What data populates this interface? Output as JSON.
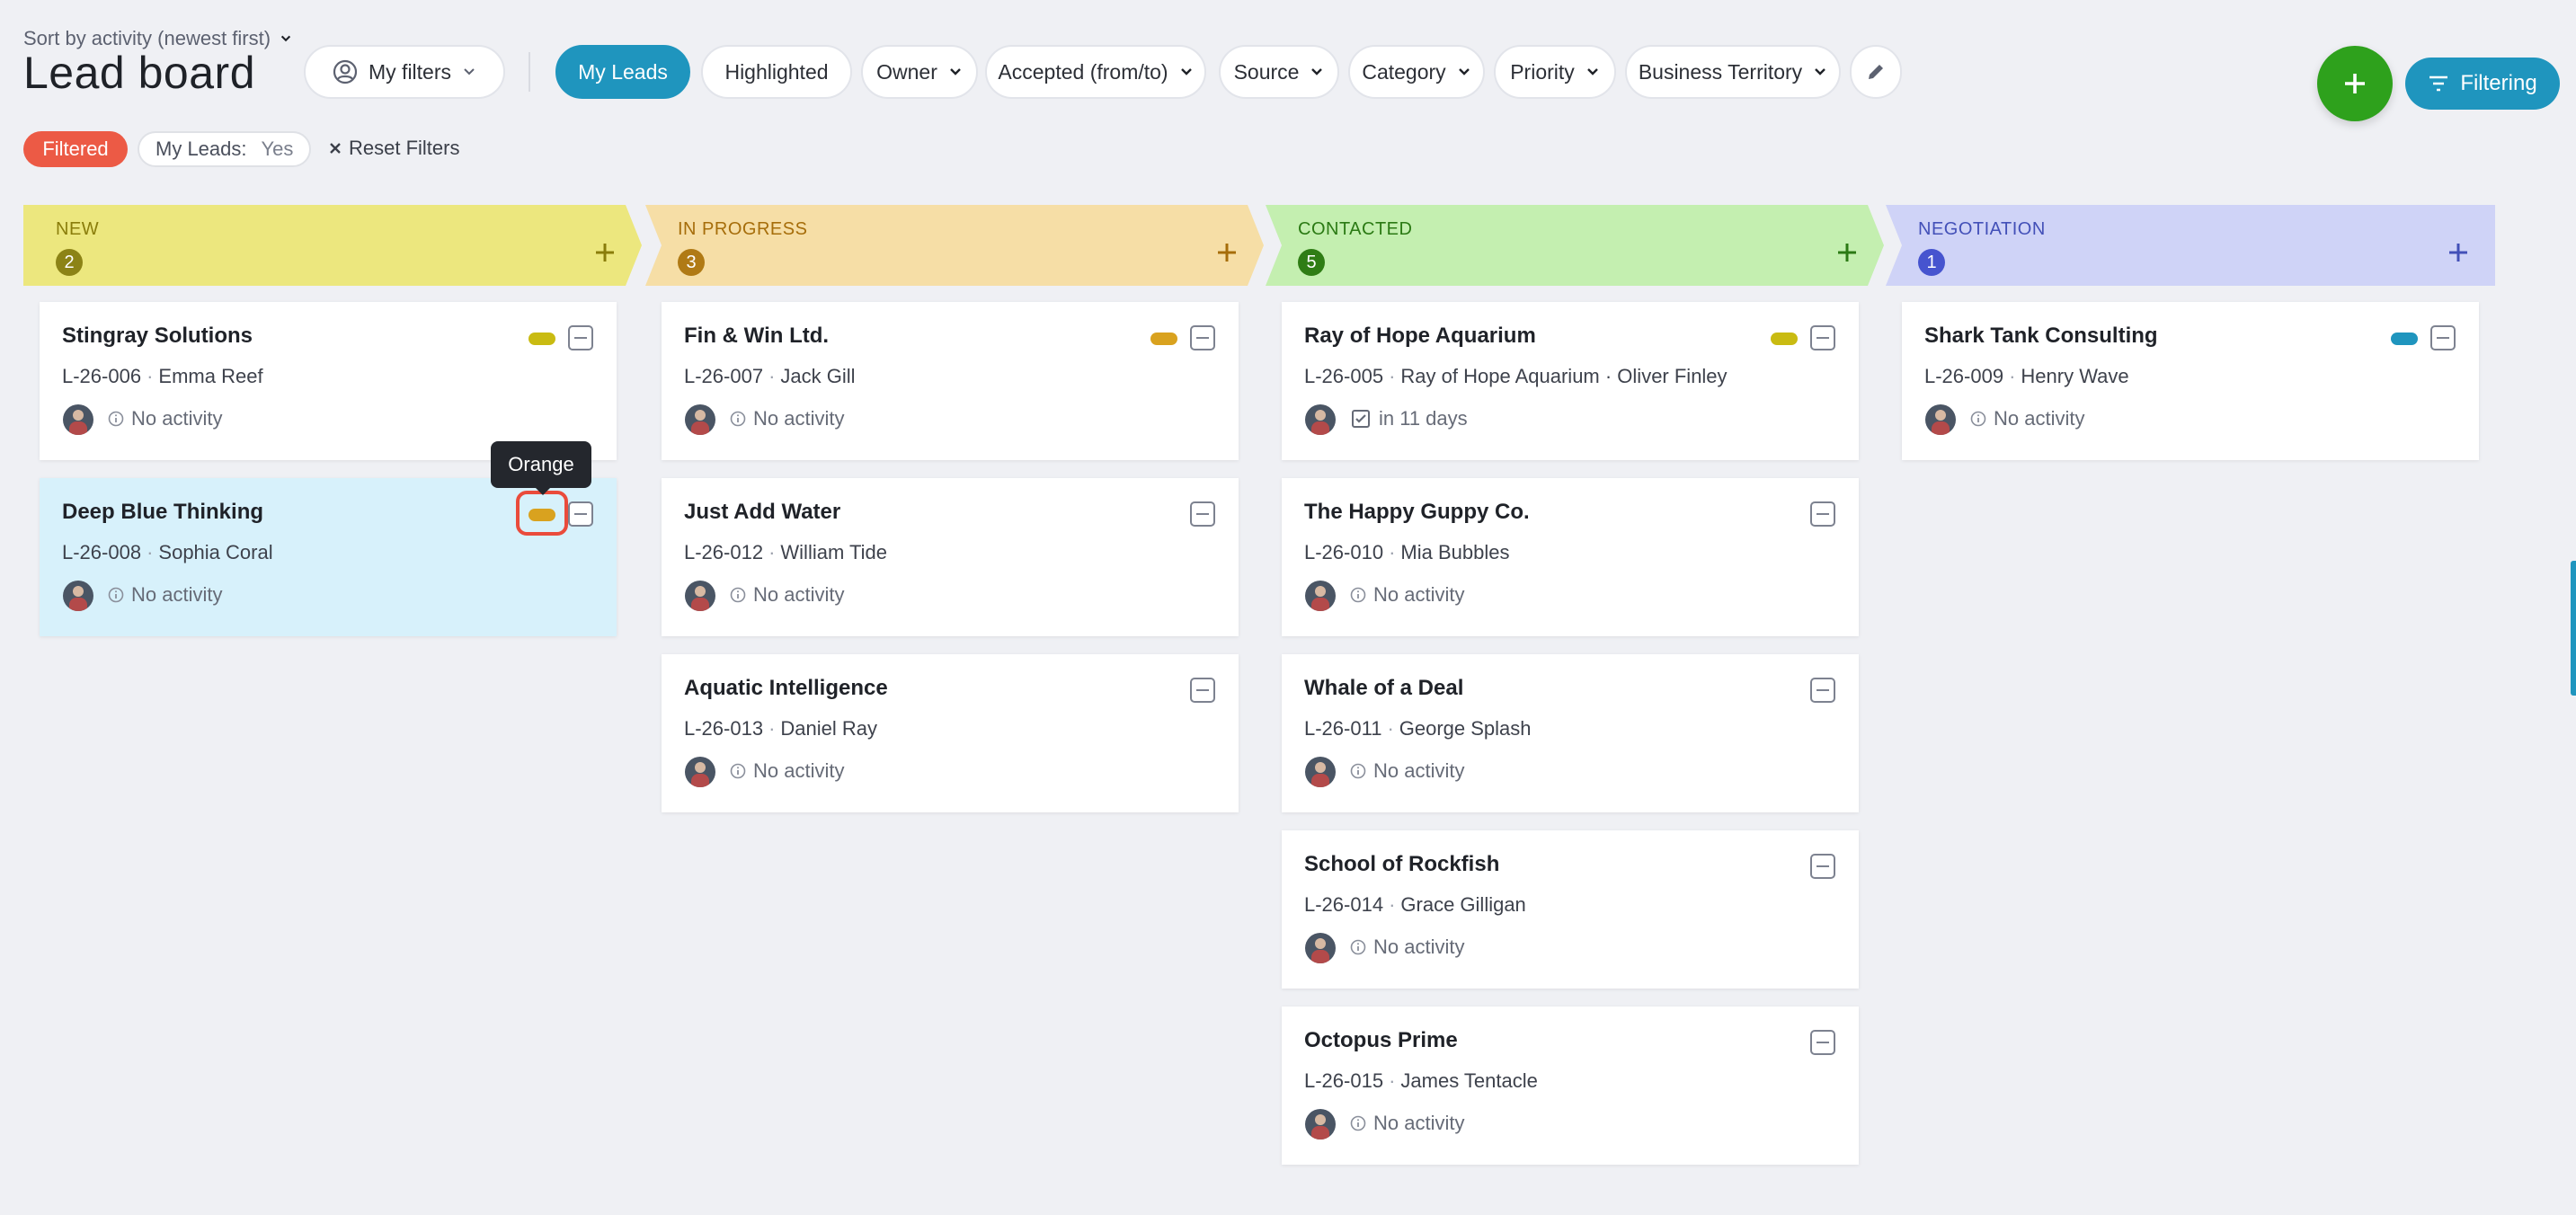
{
  "header": {
    "sort_label": "Sort by activity (newest first)",
    "title": "Lead board",
    "my_filters": "My filters",
    "filter_pills": [
      "My Leads",
      "Highlighted",
      "Owner",
      "Accepted (from/to)",
      "Source",
      "Category",
      "Priority",
      "Business Territory"
    ],
    "filtering_label": "Filtering"
  },
  "active_filters": {
    "filtered_badge": "Filtered",
    "my_leads_label": "My Leads:",
    "my_leads_value": "Yes",
    "reset_label": "Reset Filters"
  },
  "columns": [
    {
      "title": "NEW",
      "count": "2",
      "bg": "#ece77e",
      "fg": "#8a7d0b",
      "badge": "#8c8316",
      "cards": [
        {
          "name": "Stingray Solutions",
          "id": "L-26-006",
          "contact": "Emma Reef",
          "activity": "No activity",
          "activity_icon": "info-icon",
          "tag_color": "#c9bb12"
        },
        {
          "name": "Deep Blue Thinking",
          "id": "L-26-008",
          "contact": "Sophia Coral",
          "activity": "No activity",
          "activity_icon": "info-icon",
          "tag_color": "#d9a21f",
          "highlighted": true
        }
      ]
    },
    {
      "title": "IN PROGRESS",
      "count": "3",
      "bg": "#f6dea6",
      "fg": "#a66d0a",
      "badge": "#b07a15",
      "cards": [
        {
          "name": "Fin & Win Ltd.",
          "id": "L-26-007",
          "contact": "Jack Gill",
          "activity": "No activity",
          "activity_icon": "info-icon",
          "tag_color": "#d9a21f"
        },
        {
          "name": "Just Add Water",
          "id": "L-26-012",
          "contact": "William Tide",
          "activity": "No activity",
          "activity_icon": "info-icon"
        },
        {
          "name": "Aquatic Intelligence",
          "id": "L-26-013",
          "contact": "Daniel Ray",
          "activity": "No activity",
          "activity_icon": "info-icon"
        }
      ]
    },
    {
      "title": "CONTACTED",
      "count": "5",
      "bg": "#c4efb0",
      "fg": "#2b7a14",
      "badge": "#2f7d15",
      "cards": [
        {
          "name": "Ray of Hope Aquarium",
          "id": "L-26-005",
          "contact": "Ray of Hope Aquarium · Oliver Finley",
          "activity": "in 11 days",
          "activity_icon": "task-check-icon",
          "tag_color": "#c9bb12"
        },
        {
          "name": "The Happy Guppy Co.",
          "id": "L-26-010",
          "contact": "Mia Bubbles",
          "activity": "No activity",
          "activity_icon": "info-icon"
        },
        {
          "name": "Whale of a Deal",
          "id": "L-26-011",
          "contact": "George Splash",
          "activity": "No activity",
          "activity_icon": "info-icon"
        },
        {
          "name": "School of Rockfish",
          "id": "L-26-014",
          "contact": "Grace Gilligan",
          "activity": "No activity",
          "activity_icon": "info-icon"
        },
        {
          "name": "Octopus Prime",
          "id": "L-26-015",
          "contact": "James Tentacle",
          "activity": "No activity",
          "activity_icon": "info-icon"
        }
      ]
    },
    {
      "title": "NEGOTIATION",
      "count": "1",
      "bg": "#cfd3f7",
      "fg": "#4350b8",
      "badge": "#4654cf",
      "cards": [
        {
          "name": "Shark Tank Consulting",
          "id": "L-26-009",
          "contact": "Henry Wave",
          "activity": "No activity",
          "activity_icon": "info-icon",
          "tag_color": "#1f95be"
        }
      ]
    }
  ],
  "tooltip": "Orange"
}
